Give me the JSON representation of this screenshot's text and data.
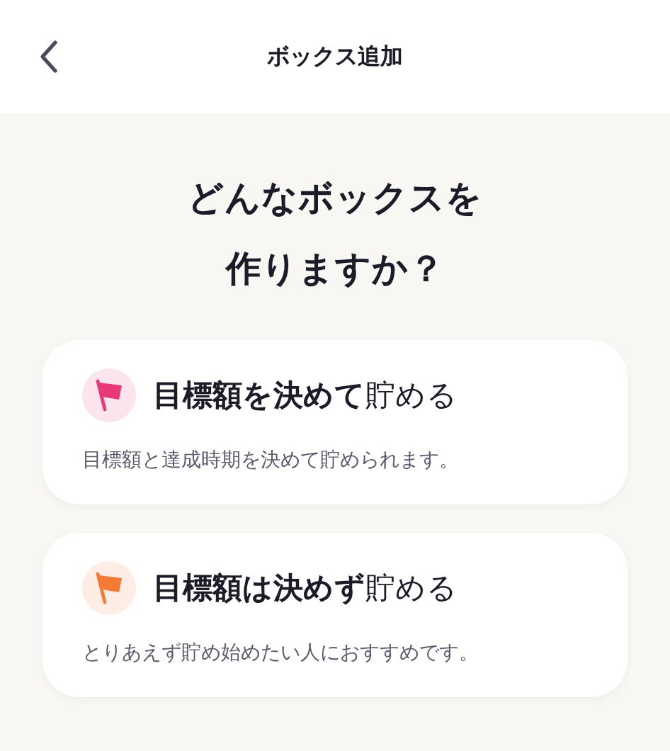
{
  "header": {
    "title": "ボックス追加"
  },
  "heading": [
    "どんなボックスを",
    "作りますか？"
  ],
  "options": [
    {
      "title": "**目標額を決めて**貯める",
      "description": "目標額と達成時期を決めて貯められます。",
      "color": "#e8387a"
    },
    {
      "title": "**目標額は決めず**貯める",
      "description": "とりあえず貯め始めたい人におすすめです。",
      "color": "#f47a35"
    }
  ]
}
